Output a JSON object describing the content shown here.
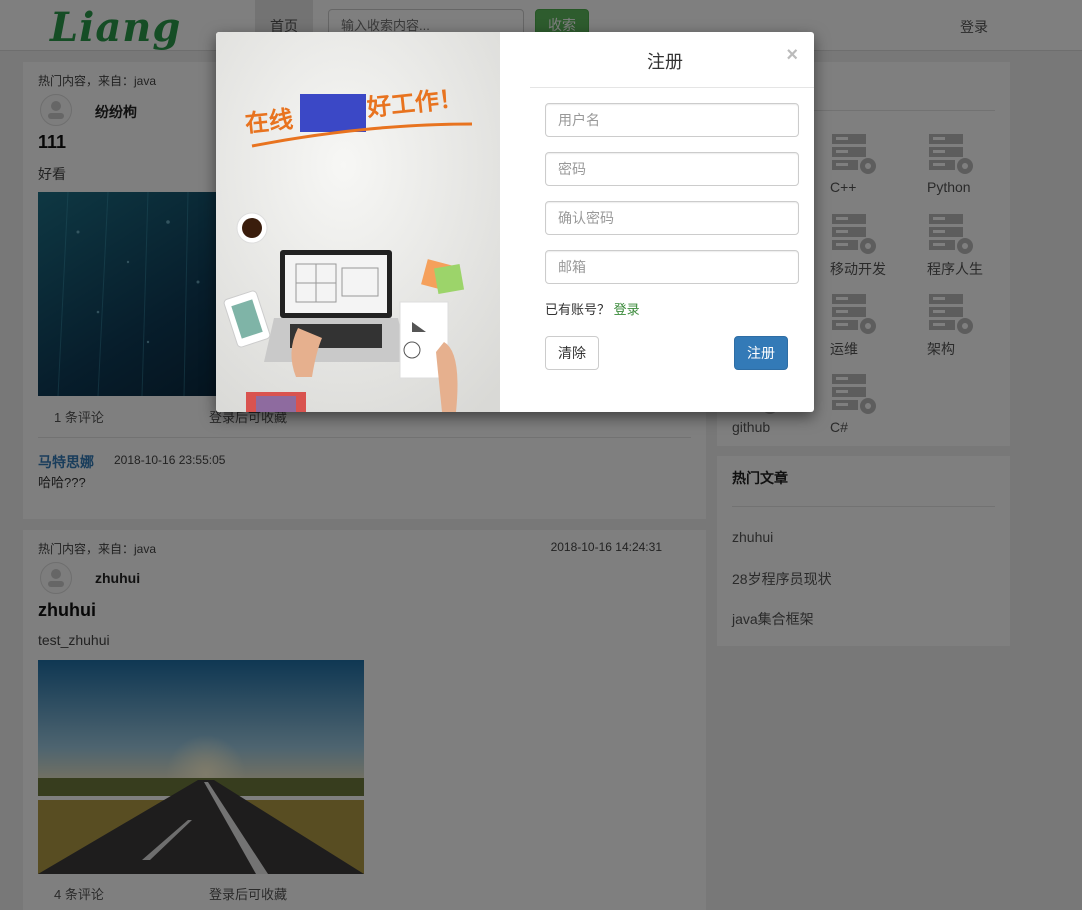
{
  "navbar": {
    "logo": "Liang",
    "home": "首页",
    "search_placeholder": "输入收索内容...",
    "search_button": "收索",
    "login": "登录"
  },
  "posts": [
    {
      "hot_from": "热门内容，来自：java",
      "date": "",
      "author": "纷纷枸",
      "title": "111",
      "summary": "好看",
      "comments": "1 条评论",
      "collect": "登录后可收藏",
      "comment": {
        "user": "马特思娜",
        "date": "2018-10-16 23:55:05",
        "text": "哈哈???"
      }
    },
    {
      "hot_from": "热门内容，来自：java",
      "date": "2018-10-16 14:24:31",
      "author": "zhuhui",
      "title": "zhuhui",
      "summary": "test_zhuhui",
      "comments": "4 条评论",
      "collect": "登录后可收藏"
    }
  ],
  "sidebar": {
    "categories": [
      "C++",
      "Python",
      "移动开发",
      "程序人生",
      "运维",
      "架构",
      "github",
      "C#"
    ],
    "hot_title": "热门文章",
    "hot_articles": [
      "zhuhui",
      "28岁程序员现状",
      "java集合框架"
    ]
  },
  "modal": {
    "title": "注册",
    "close": "×",
    "username_placeholder": "用户名",
    "password_placeholder": "密码",
    "confirm_placeholder": "确认密码",
    "email_placeholder": "邮箱",
    "have_account": "已有账号？",
    "login_link": "登录",
    "clear_button": "清除",
    "register_button": "注册",
    "banner_text_left": "在线",
    "banner_text_right": "好工作！"
  },
  "colors": {
    "green": "#5cb85c",
    "primary": "#337ab7",
    "logo": "#2a9a4a"
  }
}
